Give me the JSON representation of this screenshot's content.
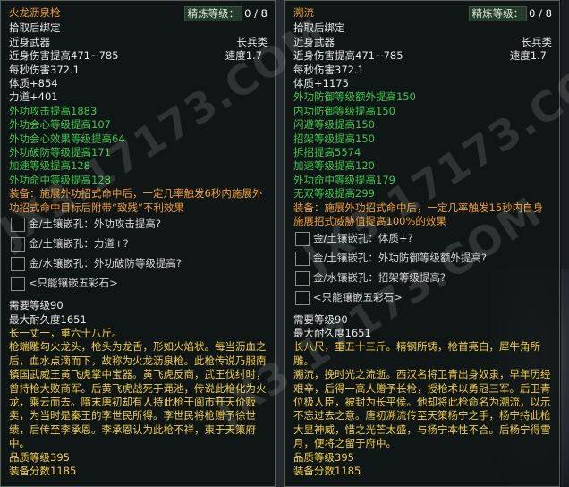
{
  "left": {
    "name": "火龙沥泉枪",
    "refine_label": "精炼等级：",
    "refine_value": "0 / 8",
    "bind": "拾取后绑定",
    "type": "近身武器",
    "weapon_class": "长兵类",
    "damage": "近身伤害提高471~785",
    "speed": "速度1.7",
    "dps": "每秒伤害372.1",
    "base_stats": [
      "体质+854",
      "力道+401"
    ],
    "green_stats": [
      "外功攻击提高1883",
      "外功会心等级提高107",
      "外功会心效果等级提高64",
      "外功破防等级提高171",
      "加速等级提高128",
      "外功命中等级提高128"
    ],
    "equip_effect": "装备：施展外功招式命中后，一定几率触发6秒内施展外功招式命中目标后附带“致残”不利效果",
    "gems": [
      "金/土镶嵌孔：外功攻击提高?",
      "金/土镶嵌孔：力道+?",
      "金/水镶嵌孔：外功破防等级提高?",
      "<只能镶嵌五彩石>"
    ],
    "required_level": "需要等级90",
    "durability": "最大耐久度1651",
    "size": "长一丈一，重六十八斤。",
    "lore": "枪端雕勾火龙头，枪头为龙舌，形如火焰状。每当沥血之后，血水点滴而下，故称为火龙沥泉枪。此枪传说乃服南镇国武威王黄飞虎掌中宝器。黄飞虎反商，武王伐纣时，曾持枪大败商军。后黄飞虎战死于渑池，传说此枪化为火龙，乘云而去。隋末唐初却有人持此枪于阆市开天价贩卖，为当时是秦王的李世民所得。李世民将枪赠予徐世绩，后传至李承恩。李承恩认为此枪不祥，束于天策府中。",
    "quality_level": "品质等级395",
    "score": "装备分数1185"
  },
  "right": {
    "name": "溯流",
    "refine_label": "精炼等级：",
    "refine_value": "0 / 8",
    "bind": "拾取后绑定",
    "type": "近身武器",
    "weapon_class": "长兵类",
    "damage": "近身伤害提高471~785",
    "speed": "速度1.7",
    "dps": "每秒伤害372.1",
    "base_stats": [
      "体质+1175"
    ],
    "green_stats": [
      "外功防御等级额外提高150",
      "内功防御等级提高150",
      "闪避等级提高150",
      "招架等级提高150",
      "拆招提高5574",
      "加速等级提高120",
      "外功命中等级提高179",
      "无双等级提高299"
    ],
    "equip_effect": "装备：施展外功招式命中后，一定几率触发15秒内自身施展招式威胁值提高100%的效果",
    "gems": [
      "金/土镶嵌孔：体质+?",
      "金/土镶嵌孔：外功防御等级额外提高?",
      "金/水镶嵌孔：招架等级提高?",
      "<只能镶嵌五彩石>"
    ],
    "required_level": "需要等级90",
    "durability": "最大耐久度1651",
    "size": "长八尺，重五十三斤。精钢所铸，枪首亮白，犀牛角所雕。",
    "lore": "溯流，挽时光之流逝。西汉名将卫青出身奴隶，早年历经艰辛，后得一高人赠予长枪，授枪术以勇冠三军。后卫青位极人臣，被封为长平侯。他却将此枪命名为溯流，以示不忘过去之意。唐初溯流传至天策杨宁之手，杨宁持此枪大显神威，惜之光芒太盛，与杨宁本性不合。后杨宁得雪月，便将之留于府中。",
    "quality_level": "品质等级395",
    "score": "装备分数1185"
  },
  "watermark": "JX3.17173.COM",
  "colors": {
    "green": "#3cc84c",
    "orange": "#f0a030",
    "yellow": "#f0d040"
  }
}
